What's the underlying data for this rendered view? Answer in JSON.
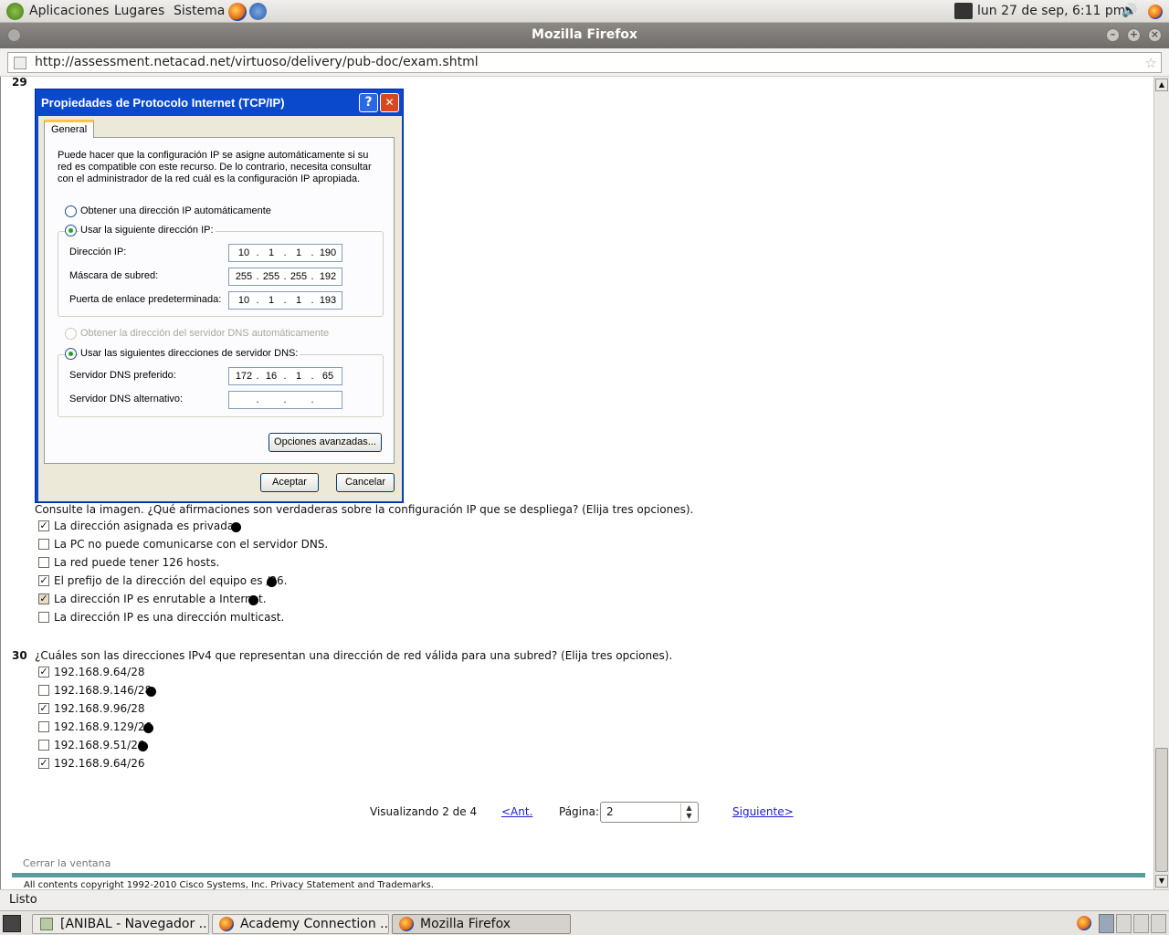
{
  "topbar": {
    "menus": [
      "Aplicaciones",
      "Lugares",
      "Sistema"
    ],
    "clock": "lun 27 de sep,  6:11 pm"
  },
  "window": {
    "title": "Mozilla Firefox"
  },
  "nav": {
    "url": "http://assessment.netacad.net/virtuoso/delivery/pub-doc/exam.shtml"
  },
  "q29": {
    "number": "29",
    "dialog": {
      "title": "Propiedades de Protocolo Internet (TCP/IP)",
      "help": "?",
      "close": "✕",
      "tab": "General",
      "intro": "Puede hacer que la configuración IP se asigne automáticamente si su red es compatible con este recurso. De lo contrario, necesita consultar con el administrador de la red cuál es la configuración IP apropiada.",
      "radio_auto_ip": "Obtener una dirección IP automáticamente",
      "radio_manual_ip": "Usar la siguiente dirección IP:",
      "ip_label": "Dirección IP:",
      "ip": [
        "10",
        "1",
        "1",
        "190"
      ],
      "mask_label": "Máscara de subred:",
      "mask": [
        "255",
        "255",
        "255",
        "192"
      ],
      "gw_label": "Puerta de enlace predeterminada:",
      "gw": [
        "10",
        "1",
        "1",
        "193"
      ],
      "radio_auto_dns": "Obtener la dirección del servidor DNS automáticamente",
      "radio_manual_dns": "Usar las siguientes direcciones de servidor DNS:",
      "dns1_label": "Servidor DNS preferido:",
      "dns1": [
        "172",
        "16",
        "1",
        "65"
      ],
      "dns2_label": "Servidor DNS alternativo:",
      "dns2": [
        "",
        ".",
        ".",
        "."
      ],
      "advanced": "Opciones avanzadas...",
      "ok": "Aceptar",
      "cancel": "Cancelar"
    },
    "question": "Consulte la imagen. ¿Qué afirmaciones son verdaderas sobre la configuración IP que se despliega? (Elija tres opciones).",
    "options": [
      {
        "text": "La dirección asignada es privada.",
        "checked": true
      },
      {
        "text": "La PC no puede comunicarse con el servidor DNS.",
        "checked": false
      },
      {
        "text": "La red puede tener 126 hosts.",
        "checked": false
      },
      {
        "text": "El prefijo de la dirección del equipo es /26.",
        "checked": true
      },
      {
        "text": "La dirección IP es enrutable a Internet.",
        "checked": true
      },
      {
        "text": "La dirección IP es una dirección multicast.",
        "checked": false
      }
    ]
  },
  "q30": {
    "number": "30",
    "question": "¿Cuáles son las direcciones IPv4 que representan una dirección de red válida para una subred? (Elija tres opciones).",
    "options": [
      {
        "text": "192.168.9.64/28",
        "checked": true
      },
      {
        "text": "192.168.9.146/28",
        "checked": false
      },
      {
        "text": "192.168.9.96/28",
        "checked": true
      },
      {
        "text": "192.168.9.129/26",
        "checked": false
      },
      {
        "text": "192.168.9.51/26",
        "checked": false
      },
      {
        "text": "192.168.9.64/26",
        "checked": true
      }
    ]
  },
  "pager": {
    "showing": "Visualizando 2 de 4",
    "prev": "<Ant.",
    "page_label": "Página:",
    "page_value": "2",
    "next": "Siguiente>"
  },
  "footer": {
    "close": "Cerrar la ventana",
    "copyright": "All contents copyright 1992-2010 Cisco Systems, Inc. Privacy Statement  and  Trademarks."
  },
  "status": "Listo",
  "taskbar": [
    "[ANIBAL - Navegador ...",
    "Academy Connection ...",
    "Mozilla Firefox"
  ]
}
